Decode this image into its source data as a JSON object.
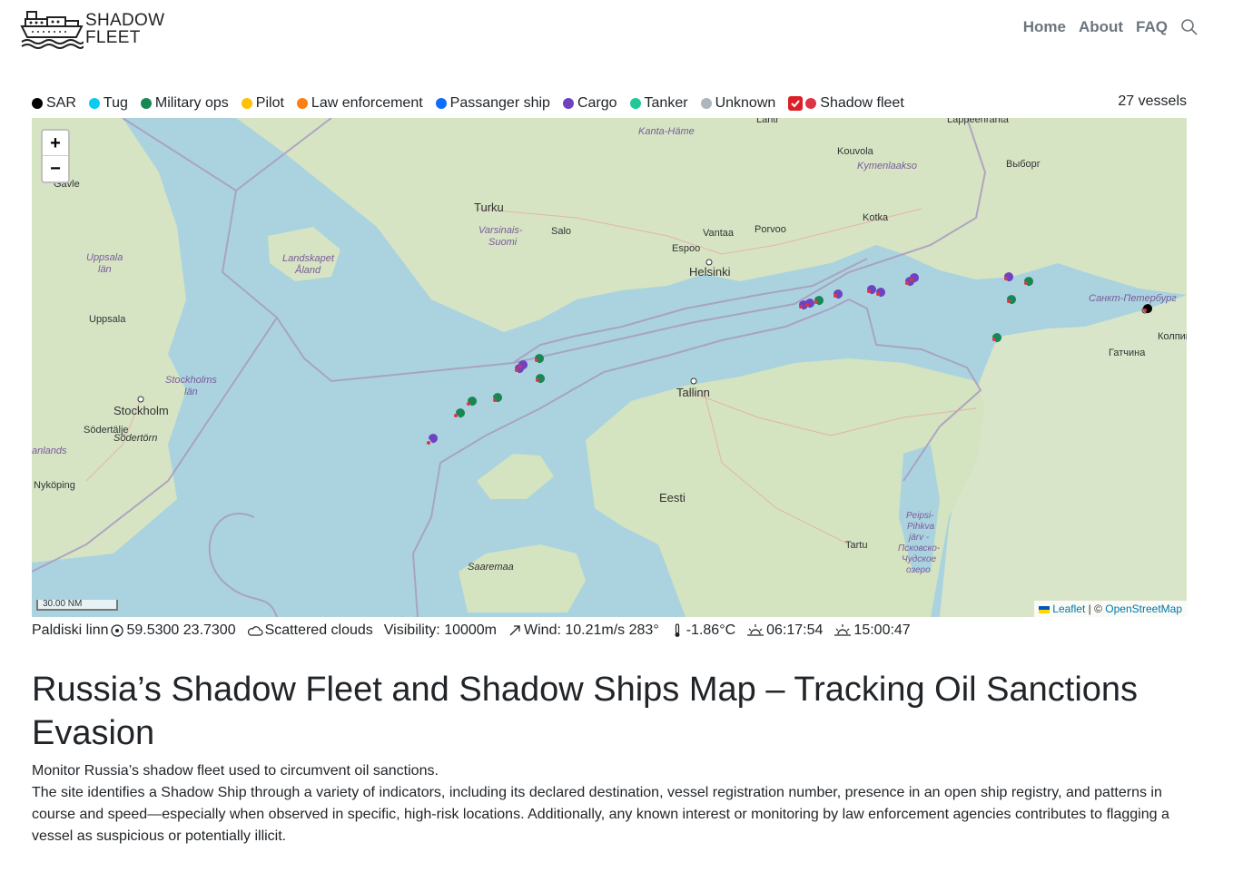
{
  "brand": {
    "line1": "SHADOW",
    "line2": "FLEET"
  },
  "nav": {
    "items": [
      "Home",
      "About",
      "FAQ"
    ]
  },
  "legend": {
    "items": [
      {
        "label": "SAR",
        "color": "#000000"
      },
      {
        "label": "Tug",
        "color": "#0dcaf0"
      },
      {
        "label": "Military ops",
        "color": "#198754"
      },
      {
        "label": "Pilot",
        "color": "#ffc107"
      },
      {
        "label": "Law enforcement",
        "color": "#fd7e14"
      },
      {
        "label": "Passanger ship",
        "color": "#0d6efd"
      },
      {
        "label": "Cargo",
        "color": "#6f42c1"
      },
      {
        "label": "Tanker",
        "color": "#20c997"
      },
      {
        "label": "Unknown",
        "color": "#adb5bd"
      }
    ],
    "shadow_fleet": {
      "label": "Shadow fleet",
      "color": "#dc3545",
      "checked": true
    },
    "vessel_count": "27 vessels"
  },
  "map": {
    "zoom_in": "+",
    "zoom_out": "−",
    "scale": "30.00 NM",
    "attribution": {
      "leaflet": "Leaflet",
      "separator": " | © ",
      "osm": "OpenStreetMap"
    },
    "labels": {
      "lahti": "Lahti",
      "lappeenranta": "Lappeenranta",
      "kanta_hame": "Kanta-Häme",
      "kouvola": "Kouvola",
      "kymenlaakso": "Kymenlaakso",
      "vyborg": "Выборг",
      "gavle": "Gävle",
      "turku": "Turku",
      "varsinais_1": "Varsinais-",
      "varsinais_2": "Suomi",
      "salo": "Salo",
      "vantaa": "Vantaa",
      "porvoo": "Porvoo",
      "kotka": "Kotka",
      "espoo": "Espoo",
      "helsinki": "Helsinki",
      "uppsala_lan_1": "Uppsala",
      "uppsala_lan_2": "län",
      "landskapet_1": "Landskapet",
      "landskapet_2": "Åland",
      "spb": "Санкт-Петербург",
      "uppsala": "Uppsala",
      "kolpino": "Колпин",
      "gatchina": "Гатчина",
      "stockholms_lan_1": "Stockholms",
      "stockholms_lan_2": "län",
      "stockholm": "Stockholm",
      "tallinn": "Tallinn",
      "sodertalje": "Södertälje",
      "sodertorn": "Södertörn",
      "anlands": "anlands",
      "nykoping": "Nyköping",
      "eesti": "Eesti",
      "tartu": "Tartu",
      "peipsi_1": "Peipsi-",
      "peipsi_2": "Pihkva",
      "peipsi_3": "järv -",
      "peipsi_4": "Псковско-",
      "peipsi_5": "Чудское",
      "peipsi_6": "озеро",
      "saaremaa": "Saaremaa"
    }
  },
  "weather": {
    "location": "Paldiski linn",
    "coords": "59.5300 23.7300",
    "conditions": "Scattered clouds",
    "visibility": "Visibility: 10000m",
    "wind": "Wind: 10.21m/s 283°",
    "temperature": "-1.86°C",
    "sunrise": "06:17:54",
    "sunset": "15:00:47"
  },
  "page": {
    "title": "Russia’s Shadow Fleet and Shadow Ships Map – Tracking Oil Sanctions Evasion",
    "intro": "Monitor Russia’s shadow fleet used to circumvent oil sanctions.",
    "body": "The site identifies a Shadow Ship through a variety of indicators, including its declared destination, vessel registration number, presence in an open ship registry, and patterns in course and speed—especially when observed in specific, high-risk locations. Additionally, any known interest or monitoring by law enforcement agencies contributes to flagging a vessel as suspicious or potentially illicit."
  },
  "vessels": [
    {
      "type": "Cargo"
    },
    {
      "type": "Cargo"
    },
    {
      "type": "Cargo"
    },
    {
      "type": "Cargo"
    },
    {
      "type": "Military ops"
    },
    {
      "type": "Cargo"
    },
    {
      "type": "Cargo"
    },
    {
      "type": "Cargo"
    },
    {
      "type": "Cargo"
    },
    {
      "type": "Cargo"
    },
    {
      "type": "Cargo"
    },
    {
      "type": "Military ops"
    },
    {
      "type": "Military ops"
    },
    {
      "type": "Military ops"
    },
    {
      "type": "Military ops"
    },
    {
      "type": "Military ops"
    },
    {
      "type": "Military ops"
    },
    {
      "type": "Military ops"
    },
    {
      "type": "Military ops"
    },
    {
      "type": "Military ops"
    },
    {
      "type": "Cargo"
    },
    {
      "type": "Cargo"
    },
    {
      "type": "Cargo"
    },
    {
      "type": "Military ops"
    },
    {
      "type": "Military ops"
    },
    {
      "type": "SAR"
    },
    {
      "type": "Cargo"
    }
  ]
}
